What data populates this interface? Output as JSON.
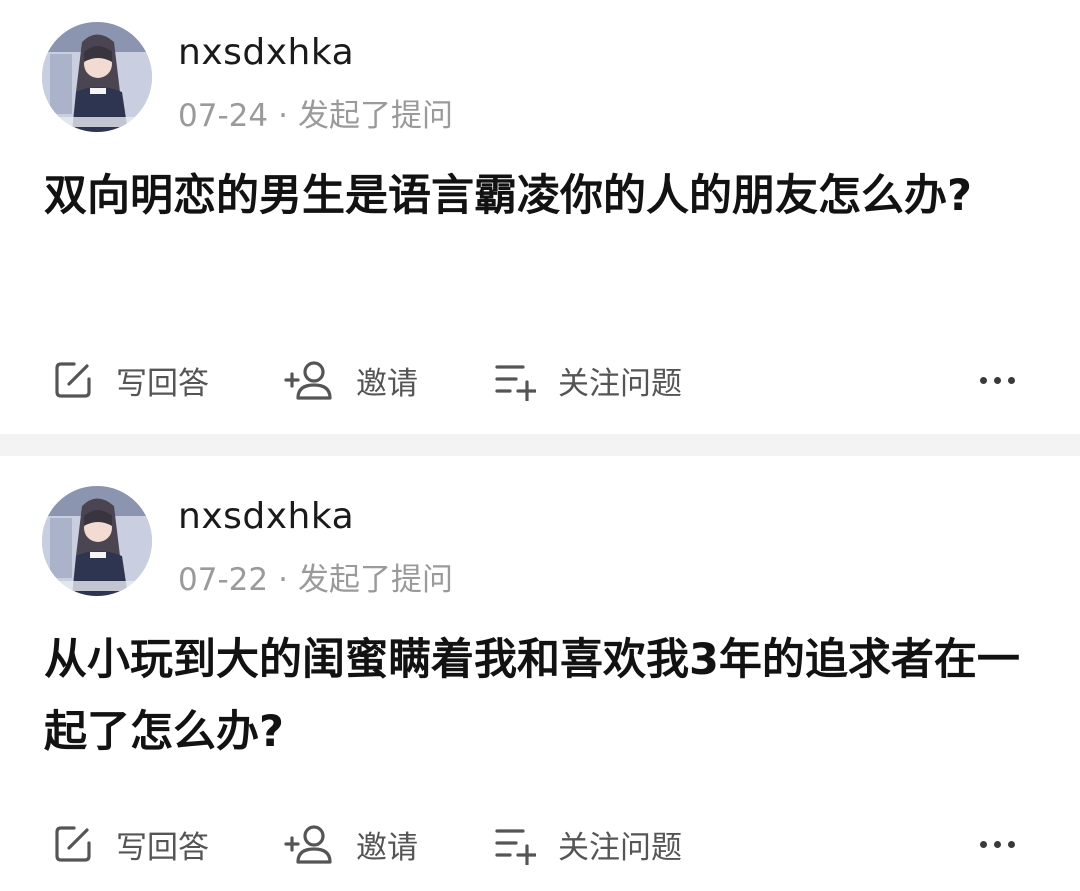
{
  "posts": [
    {
      "username": "nxsdxhka",
      "date": "07-24",
      "separator": "·",
      "action": "发起了提问",
      "question": "双向明恋的男生是语言霸凌你的人的朋友怎么办?",
      "buttons": {
        "answer": "写回答",
        "invite": "邀请",
        "follow": "关注问题"
      }
    },
    {
      "username": "nxsdxhka",
      "date": "07-22",
      "separator": "·",
      "action": "发起了提问",
      "question": "从小玩到大的闺蜜瞒着我和喜欢我3年的追求者在一起了怎么办?",
      "buttons": {
        "answer": "写回答",
        "invite": "邀请",
        "follow": "关注问题"
      }
    }
  ],
  "icons": {
    "answer": "edit-icon",
    "invite": "add-user-icon",
    "follow": "add-list-icon",
    "more": "more-horizontal-icon"
  },
  "colors": {
    "text": "#121212",
    "meta": "#9a9a9a",
    "action": "#555555",
    "divider": "#f3f3f3"
  }
}
